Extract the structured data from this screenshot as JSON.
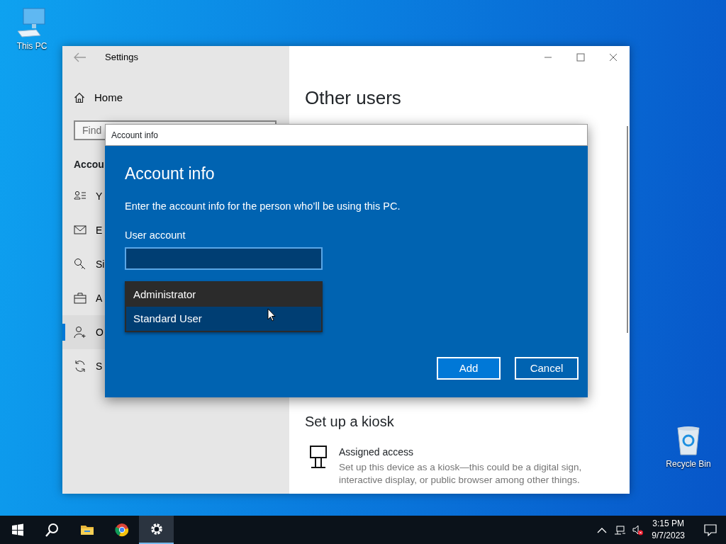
{
  "desktop_icons": [
    {
      "label": "This PC",
      "kind": "computer"
    },
    {
      "label": "Recycle Bin",
      "kind": "recycle"
    }
  ],
  "settings": {
    "title": "Settings",
    "home": "Home",
    "search": {
      "placeholder": "Find"
    },
    "section": "Accou",
    "nav": [
      {
        "label": "Y",
        "kind": "info",
        "selected": false
      },
      {
        "label": "E",
        "kind": "mail",
        "selected": false
      },
      {
        "label": "Si",
        "kind": "key",
        "selected": false
      },
      {
        "label": "A",
        "kind": "briefcase",
        "selected": false
      },
      {
        "label": "O",
        "kind": "person-add",
        "selected": true
      },
      {
        "label": "S",
        "kind": "sync",
        "selected": false
      }
    ],
    "heading": "Other users",
    "kiosk": {
      "heading": "Set up a kiosk",
      "title": "Assigned access",
      "description": "Set up this device as a kiosk—this could be a digital sign, interactive display, or public browser among other things."
    }
  },
  "dialog": {
    "title": "Account info",
    "heading": "Account info",
    "instruction": "Enter the account info for the person who’ll be using this PC.",
    "field_label": "User account",
    "options": [
      {
        "label": "Administrator",
        "selected": false
      },
      {
        "label": "Standard User",
        "selected": true
      }
    ],
    "buttons": [
      {
        "label": "Add",
        "kind": "primary"
      },
      {
        "label": "Cancel",
        "kind": "secondary"
      }
    ]
  },
  "taskbar": {
    "apps": [
      {
        "kind": "start",
        "selected": false
      },
      {
        "kind": "search",
        "selected": false
      },
      {
        "kind": "explorer",
        "selected": false
      },
      {
        "kind": "chrome",
        "selected": false
      },
      {
        "kind": "settings",
        "selected": true
      }
    ],
    "time": "3:15 PM",
    "date": "9/7/2023"
  }
}
